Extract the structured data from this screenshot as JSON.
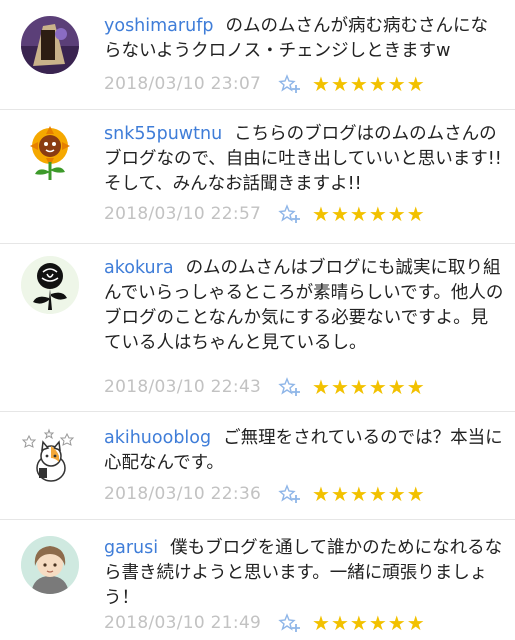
{
  "comments": [
    {
      "user": "yoshimarufp",
      "text": "のムのムさんが病む病むさんにならないようクロノス・チェンジしときますw",
      "time": "2018/03/10 23:07",
      "stars": 6
    },
    {
      "user": "snk55puwtnu",
      "text": "こちらのブログはのムのムさんのブログなので、自由に吐き出していいと思います!!そして、みんなお話聞きますよ!!",
      "time": "2018/03/10 22:57",
      "stars": 6
    },
    {
      "user": "akokura",
      "text": "のムのムさんはブログにも誠実に取り組んでいらっしゃるところが素晴らしいです。他人のブログのことなんか気にする必要ないですよ。見ている人はちゃんと見ているし。",
      "time": "2018/03/10 22:43",
      "stars": 6
    },
    {
      "user": "akihuooblog",
      "text": "ご無理をされているのでは？本当に心配なんです。",
      "time": "2018/03/10 22:36",
      "stars": 6
    },
    {
      "user": "garusi",
      "text": "僕もブログを通して誰かのためになれるなら書き続けようと思います。一緒に頑張りましょう！",
      "time": "2018/03/10 21:49",
      "stars": 6
    }
  ],
  "colors": {
    "username": "#3f7dd8",
    "timestamp": "#c2c2c2",
    "star": "#f2c100",
    "text": "#222222"
  },
  "icons": {
    "add_star": "star-plus-icon",
    "star": "star-icon"
  }
}
